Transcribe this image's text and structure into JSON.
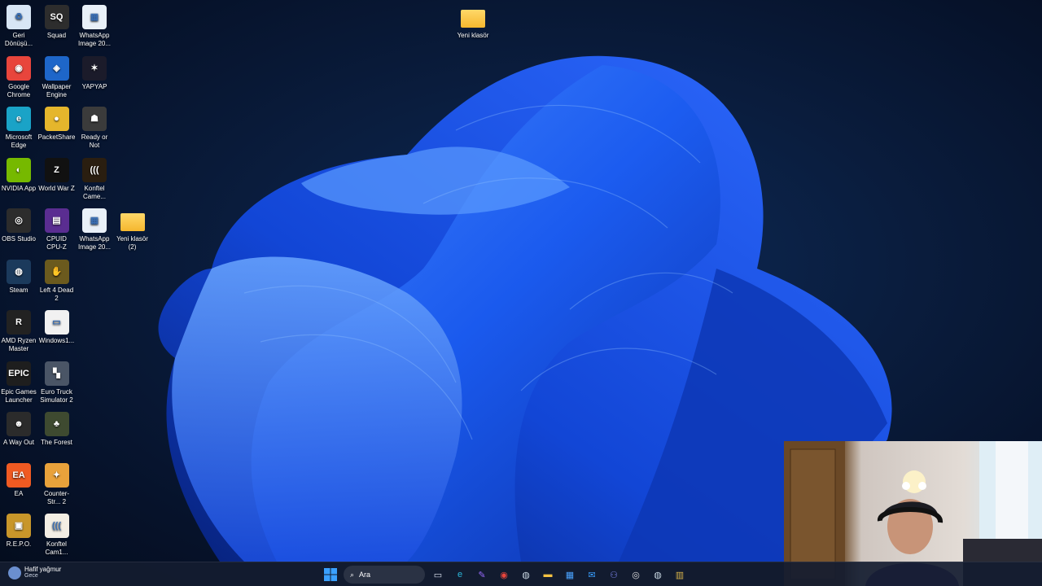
{
  "desktop_icons": [
    {
      "label": "Geri Dönüşü...",
      "icon": "recycle-bin-icon",
      "color": "#d8e6f5",
      "glyph": "♻"
    },
    {
      "label": "Squad",
      "icon": "squad-icon",
      "color": "#2d2d2d",
      "glyph": "SQ"
    },
    {
      "label": "WhatsApp Image 20...",
      "icon": "image-file-icon",
      "color": "#e9f0f8",
      "glyph": "▦"
    },
    {
      "label": "Google Chrome",
      "icon": "chrome-icon",
      "color": "#e8453c",
      "glyph": "◉"
    },
    {
      "label": "Wallpaper Engine",
      "icon": "wallpaper-engine-icon",
      "color": "#1e66c9",
      "glyph": "◈"
    },
    {
      "label": "YAPYAP",
      "icon": "yapyap-icon",
      "color": "#1b1b2a",
      "glyph": "✶"
    },
    {
      "label": "Microsoft Edge",
      "icon": "edge-icon",
      "color": "#1aa3c7",
      "glyph": "e"
    },
    {
      "label": "PacketShare",
      "icon": "packetshare-icon",
      "color": "#e5b62c",
      "glyph": "●"
    },
    {
      "label": "Ready or Not",
      "icon": "ready-or-not-icon",
      "color": "#3b3b3b",
      "glyph": "☗"
    },
    {
      "label": "NVIDIA App",
      "icon": "nvidia-icon",
      "color": "#76b900",
      "glyph": "◐"
    },
    {
      "label": "World War Z",
      "icon": "world-war-z-icon",
      "color": "#111",
      "glyph": "Z"
    },
    {
      "label": "Konftel Came...",
      "icon": "konftel-icon",
      "color": "#2a1e10",
      "glyph": "((("
    },
    {
      "label": "OBS Studio",
      "icon": "obs-icon",
      "color": "#2c2c2c",
      "glyph": "◎"
    },
    {
      "label": "CPUID CPU-Z",
      "icon": "cpuz-icon",
      "color": "#5a2d91",
      "glyph": "▤"
    },
    {
      "label": "WhatsApp Image 20...",
      "icon": "image-file-icon",
      "color": "#e9f0f8",
      "glyph": "▦"
    },
    {
      "label": "Yeni klasör (2)",
      "icon": "folder-icon",
      "color": "folder",
      "glyph": ""
    },
    {
      "label": "Steam",
      "icon": "steam-icon",
      "color": "#1b3a5c",
      "glyph": "◍"
    },
    {
      "label": "Left 4 Dead 2",
      "icon": "left4dead2-icon",
      "color": "#6b5a1e",
      "glyph": "✋"
    },
    {
      "label": "AMD Ryzen Master",
      "icon": "ryzen-master-icon",
      "color": "#222",
      "glyph": "R"
    },
    {
      "label": "Windows1...",
      "icon": "document-file-icon",
      "color": "#f1f1f1",
      "glyph": "▭"
    },
    {
      "label": "Epic Games Launcher",
      "icon": "epic-games-icon",
      "color": "#1e1e1e",
      "glyph": "EPIC"
    },
    {
      "label": "Euro Truck Simulator 2",
      "icon": "euro-truck-icon",
      "color": "#4a5566",
      "glyph": "▚"
    },
    {
      "label": "A Way Out",
      "icon": "a-way-out-icon",
      "color": "#2b2b2b",
      "glyph": "☻"
    },
    {
      "label": "The Forest",
      "icon": "the-forest-icon",
      "color": "#3e4a30",
      "glyph": "♣"
    },
    {
      "label": "EA",
      "icon": "ea-icon",
      "color": "#f05a22",
      "glyph": "EA"
    },
    {
      "label": "Counter-Str... 2",
      "icon": "counter-strike-icon",
      "color": "#e9a23b",
      "glyph": "✦"
    },
    {
      "label": "R.E.P.O.",
      "icon": "repo-icon",
      "color": "#c8962a",
      "glyph": "▣"
    },
    {
      "label": "Konftel Cam1...",
      "icon": "konftel-icon",
      "color": "#f3eee4",
      "glyph": "((("
    },
    {
      "label": "Yeni klasör",
      "icon": "folder-icon",
      "color": "folder",
      "glyph": ""
    }
  ],
  "taskbar": {
    "weather_line1": "Hafif yağmur",
    "weather_line2": "Gece",
    "search_placeholder": "Ara",
    "apps": [
      {
        "name": "task-view",
        "glyph": "▭",
        "color": "#dfe6f3"
      },
      {
        "name": "edge",
        "glyph": "e",
        "color": "#2bb6d9"
      },
      {
        "name": "copilot",
        "glyph": "✎",
        "color": "#9a6bff"
      },
      {
        "name": "chrome",
        "glyph": "◉",
        "color": "#e8453c"
      },
      {
        "name": "steam",
        "glyph": "◍",
        "color": "#c7d5e0"
      },
      {
        "name": "file-explorer",
        "glyph": "▬",
        "color": "#f5c242"
      },
      {
        "name": "store",
        "glyph": "▦",
        "color": "#4aa3ff"
      },
      {
        "name": "mail",
        "glyph": "✉",
        "color": "#3aa0ff"
      },
      {
        "name": "teams",
        "glyph": "⚇",
        "color": "#7b83eb"
      },
      {
        "name": "obs",
        "glyph": "◎",
        "color": "#dddddd"
      },
      {
        "name": "steam-2",
        "glyph": "◍",
        "color": "#c7d5e0"
      },
      {
        "name": "app-yellow",
        "glyph": "▥",
        "color": "#d9b44a"
      }
    ]
  },
  "colors": {
    "accent": "#1a6cff",
    "wallpaper_dark": "#06122a"
  }
}
